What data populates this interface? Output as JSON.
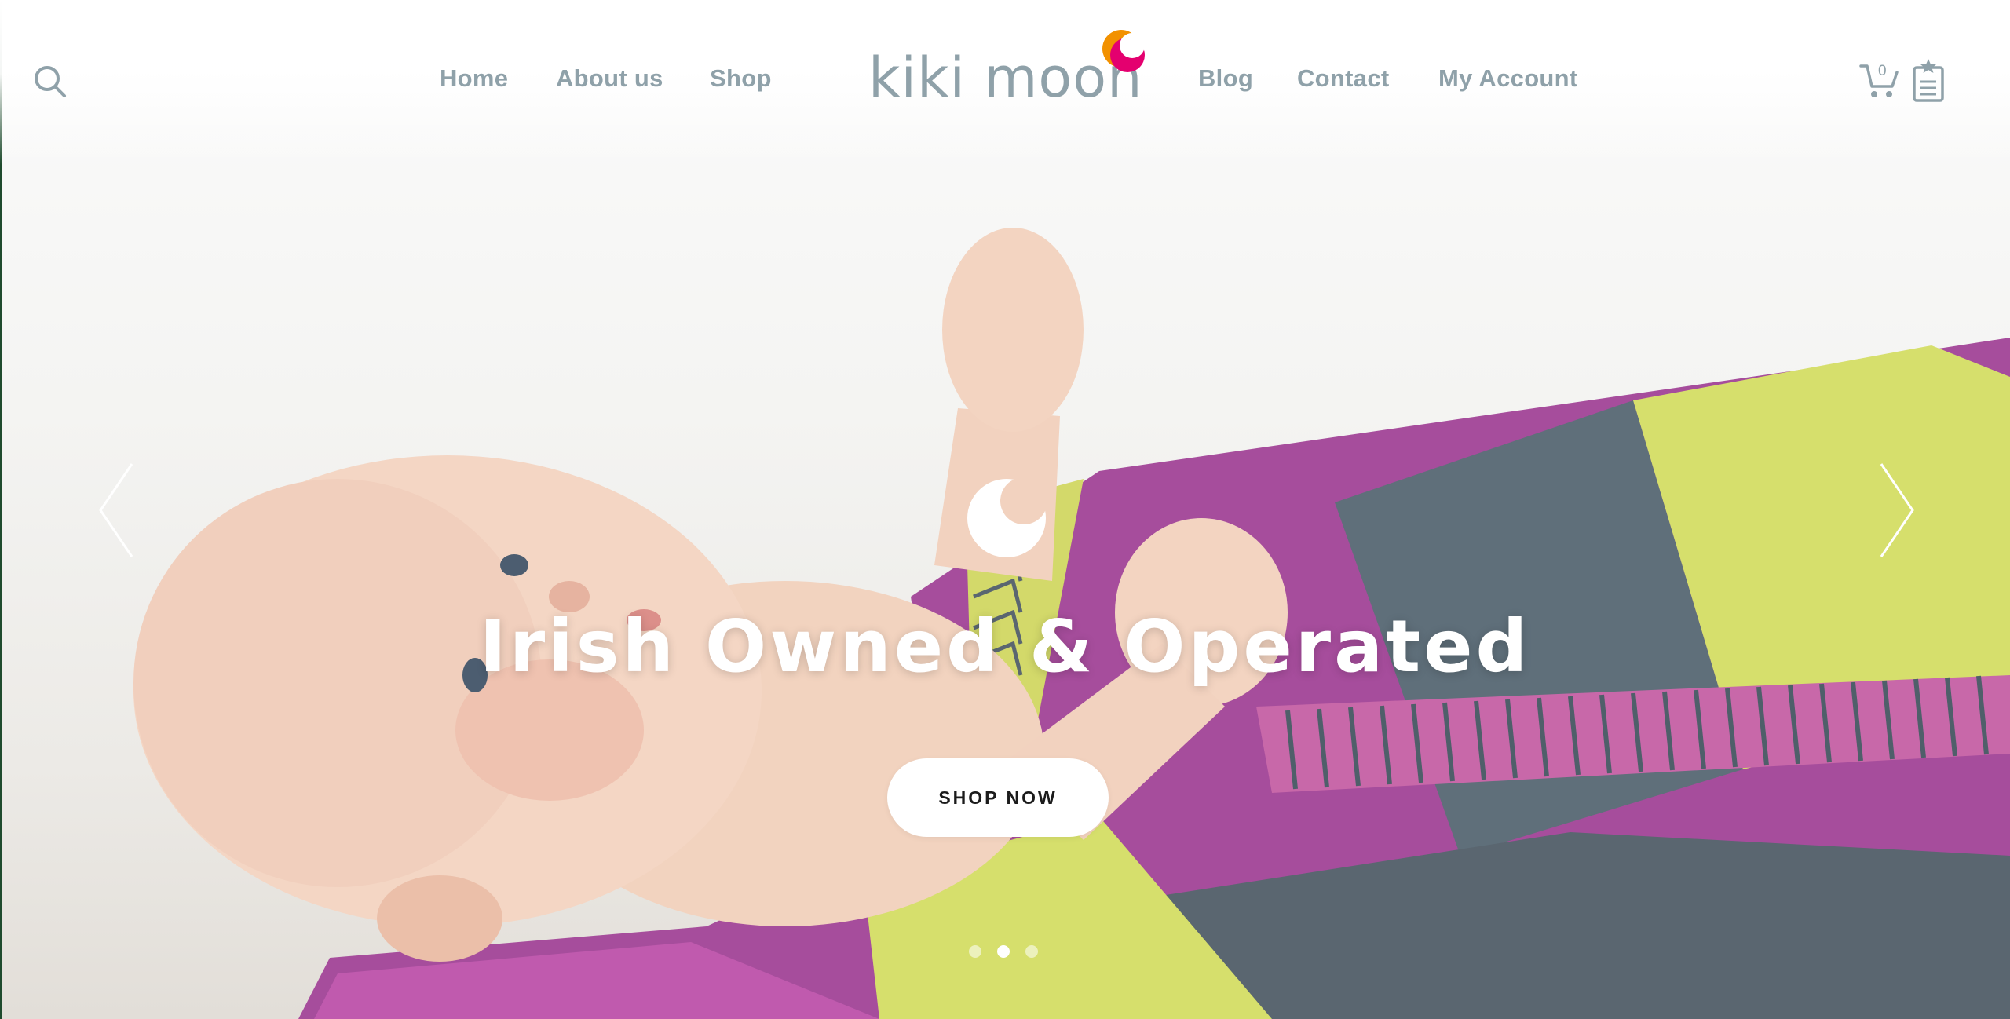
{
  "header": {
    "logo_text": "kiki moon",
    "nav_left": [
      {
        "label": "Home"
      },
      {
        "label": "About us"
      },
      {
        "label": "Shop"
      }
    ],
    "nav_right": [
      {
        "label": "Blog"
      },
      {
        "label": "Contact"
      },
      {
        "label": "My Account"
      }
    ],
    "cart_count": "0",
    "icons": {
      "search": "search-icon",
      "cart": "cart-icon",
      "wishlist": "wishlist-icon"
    }
  },
  "slider": {
    "title": "Irish Owned & Operated",
    "button_label": "SHOP NOW",
    "slide_count": 3,
    "active_slide": 2,
    "prev_icon": "chevron-left-icon",
    "next_icon": "chevron-right-icon",
    "moon_icon": "crescent-moon-icon"
  },
  "colors": {
    "nav_text": "#8fa1a9",
    "logo_orange": "#f29100",
    "logo_magenta": "#e4006f",
    "button_bg": "#ffffff",
    "title_text": "#ffffff"
  }
}
